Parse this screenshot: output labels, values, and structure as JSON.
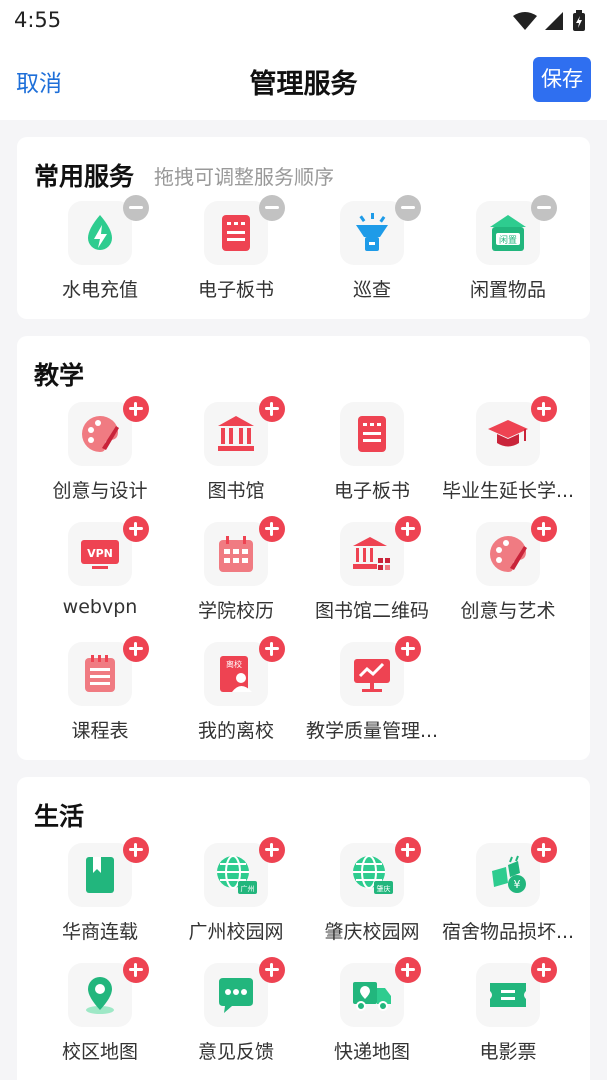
{
  "status_bar": {
    "time": "4:55",
    "icons": [
      "wifi-icon",
      "signal-icon",
      "battery-charging-icon"
    ]
  },
  "nav": {
    "cancel": "取消",
    "title": "管理服务",
    "save": "保存"
  },
  "colors": {
    "accent_blue": "#2f6ff0",
    "link_blue": "#1e6fd9",
    "add_red": "#ee4352",
    "remove_gray": "#c2c2c2",
    "icon_green": "#2ecc8f",
    "icon_red": "#ee4352"
  },
  "sections": {
    "common": {
      "title": "常用服务",
      "hint": "拖拽可调整服务顺序",
      "items": [
        {
          "label": "水电充值",
          "icon": "water-electric-icon"
        },
        {
          "label": "电子板书",
          "icon": "e-board-icon"
        },
        {
          "label": "巡查",
          "icon": "patrol-light-icon"
        },
        {
          "label": "闲置物品",
          "icon": "idle-goods-icon"
        }
      ]
    },
    "teaching": {
      "title": "教学",
      "items": [
        {
          "label": "创意与设计",
          "icon": "palette-icon"
        },
        {
          "label": "图书馆",
          "icon": "library-icon"
        },
        {
          "label": "电子板书",
          "icon": "e-board-icon"
        },
        {
          "label": "毕业生延长学...",
          "icon": "graduation-cap-icon"
        },
        {
          "label": "webvpn",
          "icon": "vpn-icon"
        },
        {
          "label": "学院校历",
          "icon": "calendar-icon"
        },
        {
          "label": "图书馆二维码",
          "icon": "library-qr-icon"
        },
        {
          "label": "创意与艺术",
          "icon": "palette-icon"
        },
        {
          "label": "课程表",
          "icon": "timetable-icon"
        },
        {
          "label": "我的离校",
          "icon": "leave-school-icon"
        },
        {
          "label": "教学质量管理...",
          "icon": "quality-chart-icon"
        }
      ]
    },
    "life": {
      "title": "生活",
      "items": [
        {
          "label": "华商连载",
          "icon": "bookmark-book-icon"
        },
        {
          "label": "广州校园网",
          "icon": "globe-guangzhou-icon"
        },
        {
          "label": "肇庆校园网",
          "icon": "globe-zhaoqing-icon"
        },
        {
          "label": "宿舍物品损坏...",
          "icon": "damage-compensation-icon"
        },
        {
          "label": "校区地图",
          "icon": "map-pin-icon"
        },
        {
          "label": "意见反馈",
          "icon": "feedback-chat-icon"
        },
        {
          "label": "快递地图",
          "icon": "delivery-truck-icon"
        },
        {
          "label": "电影票",
          "icon": "movie-ticket-icon"
        }
      ]
    }
  },
  "glyphs": {
    "guangzhou": "广州",
    "zhaoqing": "肇庆",
    "idle": "闲置",
    "leave": "离校",
    "vpn": "VPN",
    "yen": "¥"
  }
}
